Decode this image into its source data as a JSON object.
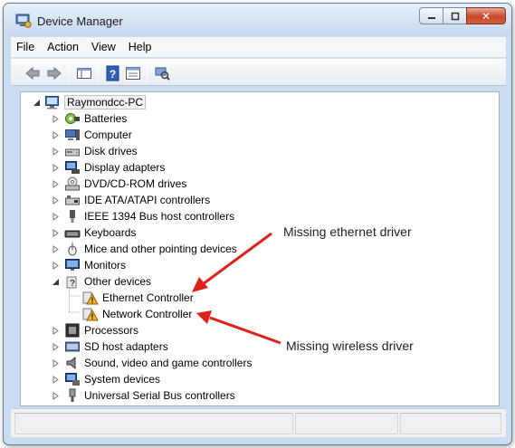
{
  "window": {
    "title": "Device Manager"
  },
  "menu": [
    "File",
    "Action",
    "View",
    "Help"
  ],
  "toolbar": {
    "buttons": [
      "back-arrow-icon",
      "forward-arrow-icon",
      "console-tree-icon",
      "help-icon",
      "properties-icon",
      "scan-hardware-icon"
    ]
  },
  "tree": {
    "root": "Raymondcc-PC",
    "categories": [
      {
        "label": "Batteries",
        "icon": "battery-icon"
      },
      {
        "label": "Computer",
        "icon": "computer-icon"
      },
      {
        "label": "Disk drives",
        "icon": "disk-drive-icon"
      },
      {
        "label": "Display adapters",
        "icon": "display-adapter-icon"
      },
      {
        "label": "DVD/CD-ROM drives",
        "icon": "dvd-drive-icon"
      },
      {
        "label": "IDE ATA/ATAPI controllers",
        "icon": "ide-controller-icon"
      },
      {
        "label": "IEEE 1394 Bus host controllers",
        "icon": "firewire-icon"
      },
      {
        "label": "Keyboards",
        "icon": "keyboard-icon"
      },
      {
        "label": "Mice and other pointing devices",
        "icon": "mouse-icon"
      },
      {
        "label": "Monitors",
        "icon": "monitor-icon"
      },
      {
        "label": "Other devices",
        "icon": "unknown-device-icon",
        "expanded": true,
        "children": [
          {
            "label": "Ethernet Controller",
            "icon": "warning-device-icon"
          },
          {
            "label": "Network Controller",
            "icon": "warning-device-icon"
          }
        ]
      },
      {
        "label": "Processors",
        "icon": "processor-icon"
      },
      {
        "label": "SD host adapters",
        "icon": "sd-adapter-icon"
      },
      {
        "label": "Sound, video and game controllers",
        "icon": "speaker-icon"
      },
      {
        "label": "System devices",
        "icon": "system-device-icon"
      },
      {
        "label": "Universal Serial Bus controllers",
        "icon": "usb-icon"
      }
    ]
  },
  "annotations": {
    "ethernet": "Missing ethernet driver",
    "wireless": "Missing wireless driver",
    "arrow_color": "#e0201b"
  }
}
